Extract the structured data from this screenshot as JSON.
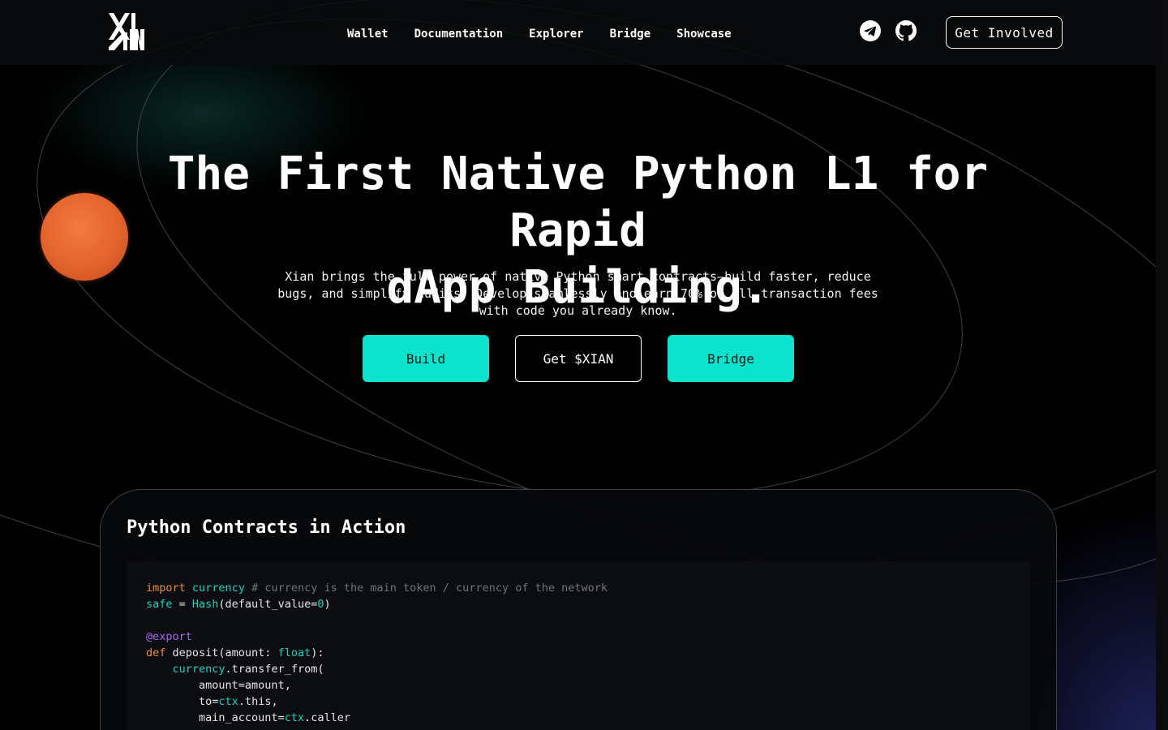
{
  "header": {
    "logo_alt": "XIAN",
    "nav": [
      "Wallet",
      "Documentation",
      "Explorer",
      "Bridge",
      "Showcase"
    ],
    "social": [
      "telegram-icon",
      "github-icon"
    ],
    "cta_label": "Get Involved"
  },
  "hero": {
    "title_line1": "The First Native Python L1 for Rapid",
    "title_line2": "dApp Building.",
    "subtitle": "Xian brings the full power of native Python smart contracts—build faster, reduce bugs, and simplify audits. Develop seamlessly and earn 70% of all transaction fees with code you already know.",
    "buttons": [
      "Build",
      "Get $XIAN",
      "Bridge"
    ]
  },
  "code_section": {
    "title": "Python Contracts in Action",
    "lines": {
      "l1_kw": "import",
      "l1_mod": "currency",
      "l1_comment": "# currency is the main token / currency of the network",
      "l2_var": "safe",
      "l2_eq": " = ",
      "l2_cls": "Hash",
      "l2_args_a": "(default_value=",
      "l2_num": "0",
      "l2_args_b": ")",
      "l4_dec": "@export",
      "l5_kw": "def",
      "l5_sig_a": " deposit(amount: ",
      "l5_type": "float",
      "l5_sig_b": "):",
      "l6_obj": "currency",
      "l6_call": ".transfer_from(",
      "l7": "amount=amount,",
      "l8_a": "to=",
      "l8_ctx": "ctx",
      "l8_b": ".this,",
      "l9_a": "main_account=",
      "l9_ctx": "ctx",
      "l9_b": ".caller"
    }
  },
  "colors": {
    "accent": "#0be3cc",
    "planet": "#e4632c",
    "keyword": "#f08a3c",
    "decorator": "#a66bf5"
  }
}
